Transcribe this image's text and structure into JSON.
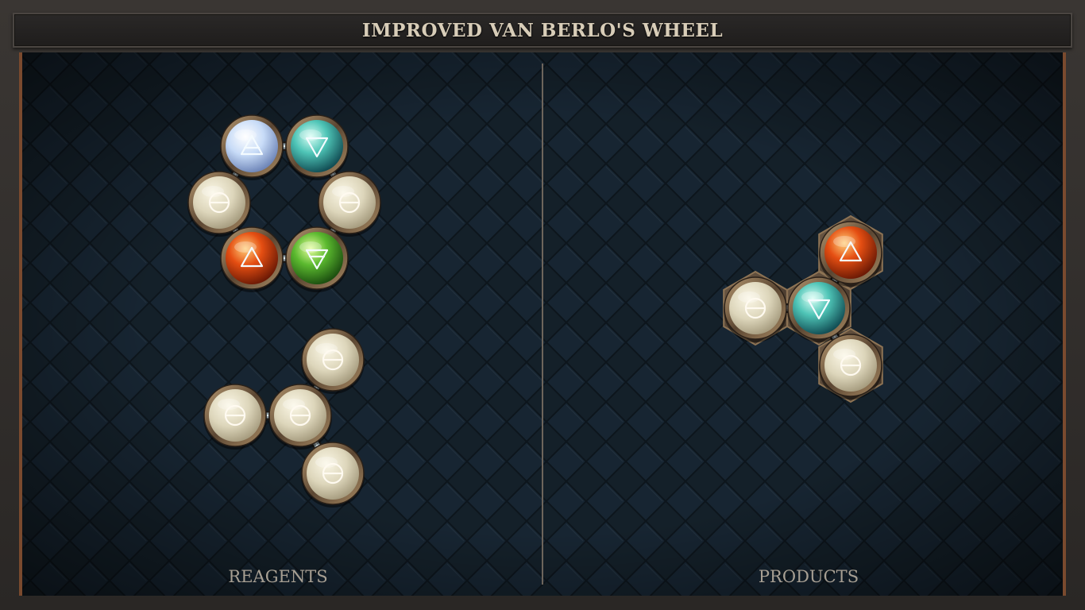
{
  "title": "IMPROVED VAN BERLO'S WHEEL",
  "panels": {
    "reagents": {
      "label": "REAGENTS"
    },
    "products": {
      "label": "PRODUCTS"
    }
  },
  "colors": {
    "salt": "#e6e0c8",
    "air": "#cfe0f8",
    "water": "#5ec9c0",
    "fire": "#e8561a",
    "earth": "#6ac23a",
    "frame_accent": "#7a4a2e",
    "background": "#131c24"
  },
  "reagents": [
    {
      "name": "wheel-molecule",
      "atoms": [
        "air",
        "water",
        "salt",
        "earth",
        "fire",
        "salt"
      ],
      "bonds": [
        [
          0,
          1
        ],
        [
          1,
          2
        ],
        [
          2,
          3
        ],
        [
          3,
          4
        ],
        [
          4,
          5
        ],
        [
          5,
          0
        ]
      ]
    },
    {
      "name": "salt-cluster-molecule",
      "atoms": [
        "salt",
        "salt",
        "salt",
        "salt"
      ],
      "bonds": [
        [
          0,
          1
        ],
        [
          1,
          2
        ],
        [
          1,
          3
        ]
      ]
    }
  ],
  "products": [
    {
      "name": "product-molecule",
      "atoms": [
        "salt",
        "water",
        "fire",
        "salt"
      ],
      "bonds": [
        [
          0,
          1
        ],
        [
          1,
          2
        ],
        [
          1,
          3
        ]
      ]
    }
  ]
}
